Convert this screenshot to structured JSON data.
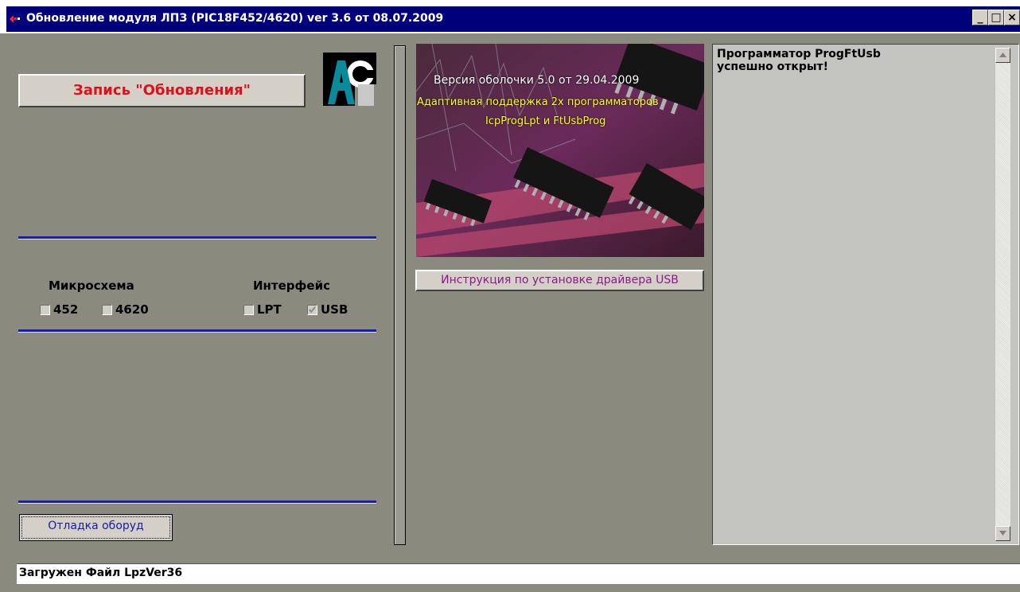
{
  "window": {
    "title": "Обновление модуля ЛПЗ (PIC18F452/4620) ver 3.6 от 08.07.2009",
    "controls": [
      "minimize-icon",
      "maximize-icon",
      "close-icon"
    ],
    "minimize_glyph": "_",
    "maximize_glyph": "□",
    "close_glyph": "×"
  },
  "left_panel": {
    "write_button_label": "Запись \"Обновления\"",
    "logo_icon": "aa-logo-icon",
    "chip_section_label": "Микросхема",
    "interface_section_label": "Интерфейс",
    "chip_options": [
      {
        "label": "452",
        "checked": false
      },
      {
        "label": "4620",
        "checked": false
      }
    ],
    "interface_options": [
      {
        "label": "LPT",
        "checked": false
      },
      {
        "label": "USB",
        "checked": true
      }
    ],
    "debug_button_label": "Отладка оборуд"
  },
  "center_panel": {
    "shell_version": "Версия оболочки 5.0 от 29.04.2009",
    "support_line1": "Адаптивная поддержка 2х программаторов",
    "support_line2": "IcpProgLpt и FtUsbProg",
    "usb_button_label": "Инструкция по установке драйвера USB"
  },
  "log_panel": {
    "text": "Программатор ProgFtUsb\nуспешно открыт!"
  },
  "status_bar": {
    "text": "Загружен Файл LpzVer36"
  },
  "colors": {
    "titlebar": "#00007b",
    "window_bg": "#8a8a7e",
    "write_label": "#e0101a",
    "separator": "#1a1ab8"
  }
}
